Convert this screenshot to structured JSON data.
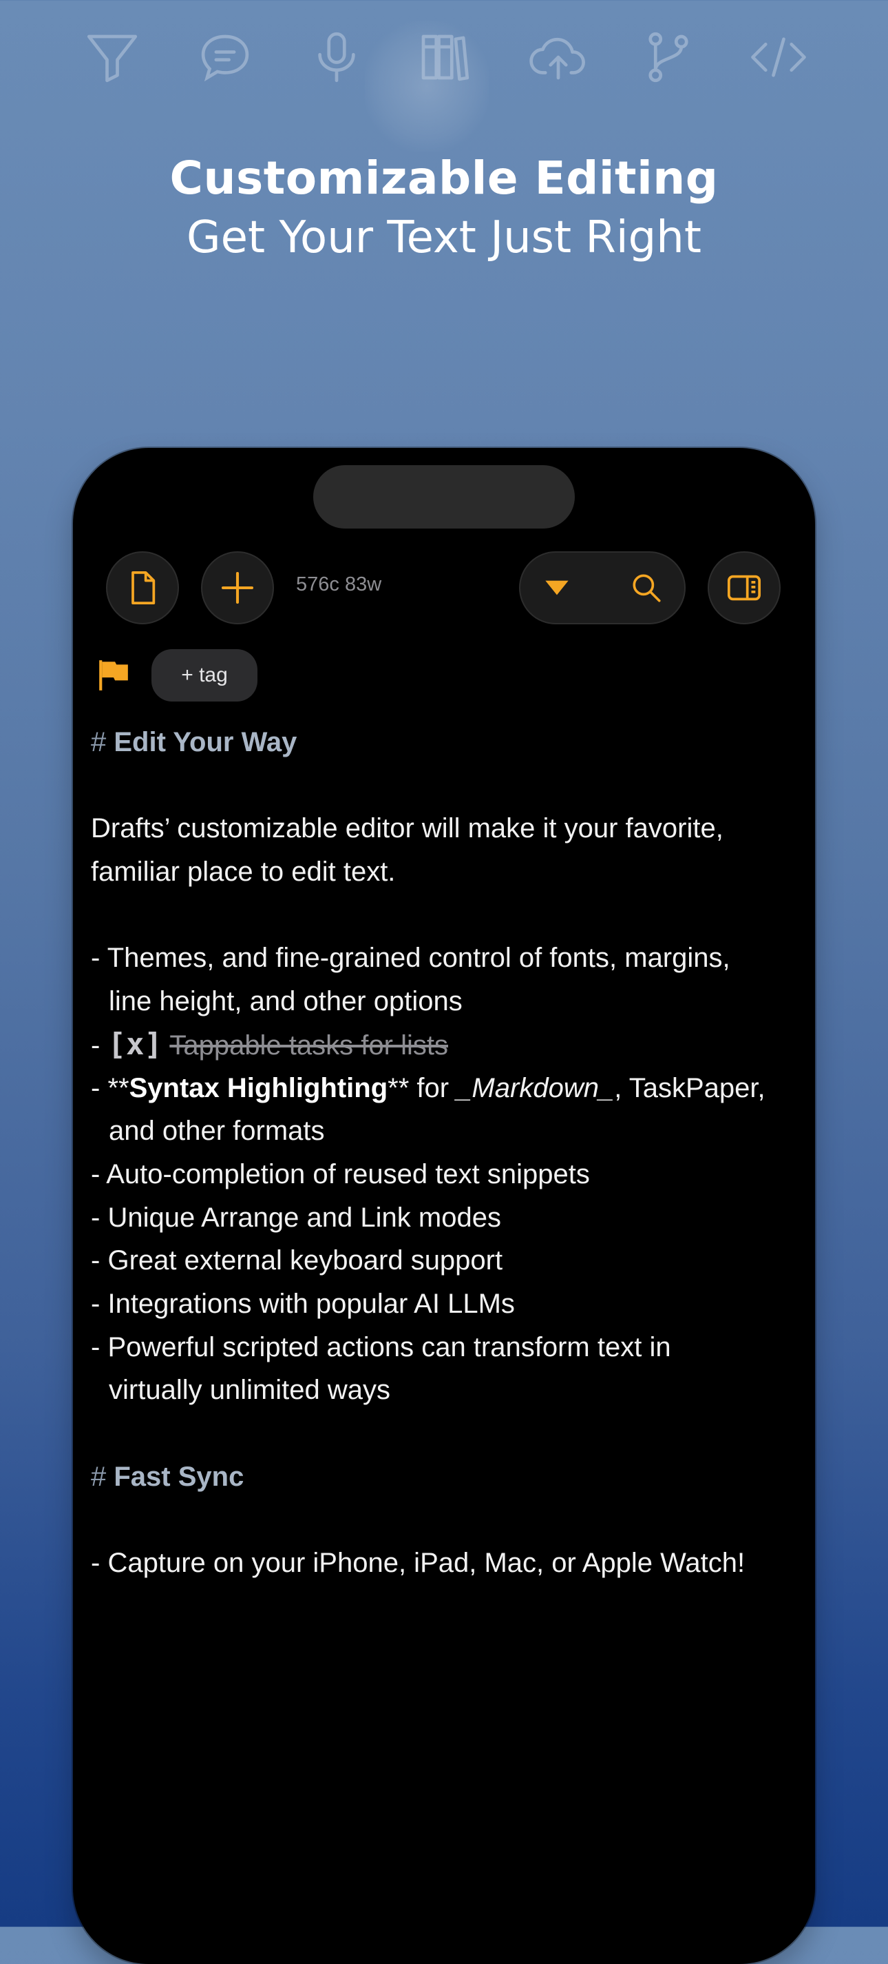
{
  "toolbar_icons": [
    {
      "name": "filter-icon"
    },
    {
      "name": "comment-icon"
    },
    {
      "name": "microphone-icon"
    },
    {
      "name": "library-icon"
    },
    {
      "name": "cloud-upload-icon"
    },
    {
      "name": "branch-icon"
    },
    {
      "name": "code-icon"
    }
  ],
  "hero": {
    "title": "Customizable Editing",
    "subtitle": "Get Your Text Just Right"
  },
  "editor_toolbar": {
    "counter": "576c 83w",
    "tag_button": "+ tag",
    "accent_color": "#F5A623"
  },
  "editor": {
    "heading1_marker": "#",
    "heading1": "Edit Your Way",
    "intro_line1": "Drafts’ customizable editor will make it your favorite,",
    "intro_line2": "familiar place to edit text.",
    "bullet_marker": "-",
    "item1_line1": "Themes, and fine-grained control of fonts, margins,",
    "item1_line2": "line height, and other options",
    "task_box": "[x]",
    "task_text": "Tappable tasks for lists",
    "item3_bold_open": "**",
    "item3_bold": "Syntax Highlighting",
    "item3_bold_close": "**",
    "item3_for": " for ",
    "item3_italic": "_Markdown_",
    "item3_rest": ", TaskPaper,",
    "item3_line2": "and other formats",
    "item4": "Auto-completion of reused text snippets",
    "item5": "Unique Arrange and Link modes",
    "item6": "Great external keyboard support",
    "item7": "Integrations with popular AI LLMs",
    "item8_line1": "Powerful scripted actions can transform text in",
    "item8_line2": "virtually unlimited ways",
    "heading2_marker": "#",
    "heading2": "Fast Sync",
    "item9": "Capture on your iPhone, iPad, Mac, or Apple Watch!"
  }
}
